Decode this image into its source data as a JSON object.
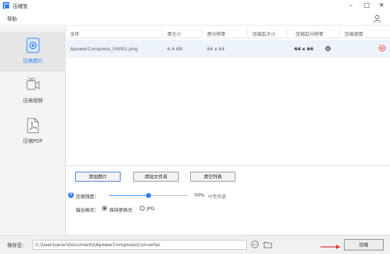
{
  "window": {
    "title": "压缩宝"
  },
  "menu": {
    "help": "帮助"
  },
  "sidebar": {
    "items": [
      {
        "label": "压缩图片",
        "icon": "image-icon"
      },
      {
        "label": "压缩视频",
        "icon": "video-icon"
      },
      {
        "label": "压缩PDF",
        "icon": "pdf-icon"
      }
    ]
  },
  "table": {
    "headers": [
      "文件",
      "原大小",
      "原分辨率",
      "压缩后大小",
      "压缩后分辨率",
      "压缩进度"
    ],
    "rows": [
      {
        "file": "ApowerCompress_00001.png",
        "orig_size": "6.4 KB",
        "orig_res": "64 x 64",
        "new_size": "",
        "new_res": "64 x 64",
        "progress": ""
      }
    ]
  },
  "actions": {
    "add_image": "添加图片",
    "add_folder": "添加文件夹",
    "clear_list": "清空列表"
  },
  "settings": {
    "help_badge": "?",
    "strength_label": "压缩强度：",
    "strength_value": "50%",
    "strength_level": 0.5,
    "strength_desc": "中等质量",
    "format_label": "输出格式：",
    "format_options": [
      "保持原格式",
      "JPG"
    ],
    "format_selected": "保持原格式"
  },
  "footer": {
    "save_label": "保存至:",
    "save_path": "C:\\Users\\acer\\Documents\\ApowerCompress\\Converter",
    "more_button": "···",
    "compress_button": "压缩"
  },
  "colors": {
    "accent": "#2f7ef5",
    "arrow": "#e03030",
    "delete": "#e04040"
  }
}
